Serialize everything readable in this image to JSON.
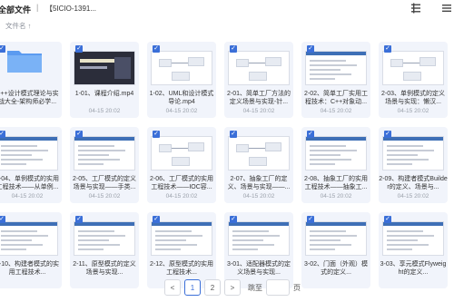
{
  "breadcrumb": {
    "root": "全部文件",
    "separator": "|",
    "current": "【5ICIO-1391..."
  },
  "sort": {
    "label": "文件名",
    "arrow": "↑"
  },
  "rows": [
    [
      {
        "name": "C++设计模式理论与实战大全-架构师必学...",
        "date": "",
        "kind": "folder"
      },
      {
        "name": "1-01、课程介绍.mp4",
        "date": "04-15 20:02",
        "kind": "dark"
      },
      {
        "name": "1-02、UML和设计模式导论.mp4",
        "date": "04-15 20:02",
        "kind": "diagram"
      },
      {
        "name": "2-01、简单工厂方法的定义场景与实现-针...",
        "date": "04-15 20:02",
        "kind": "diagram"
      },
      {
        "name": "2-02、简单工厂实用工程技术：C++对象动...",
        "date": "04-15 20:02",
        "kind": "code"
      },
      {
        "name": "2-03、单例模式的定义场景与实现：懒汉...",
        "date": "04-15 20:02",
        "kind": "diagram"
      }
    ],
    [
      {
        "name": "2-04、单例模式的实用工程技术——从单例...",
        "date": "04-15 20:02",
        "kind": "code"
      },
      {
        "name": "2-05、工厂模式的定义场景与实现——手类...",
        "date": "04-15 20:02",
        "kind": "code"
      },
      {
        "name": "2-06、工厂模式的实用工程技术——IOC容...",
        "date": "04-15 20:02",
        "kind": "diagram"
      },
      {
        "name": "2-07、抽象工厂的定义、场景与实现——...",
        "date": "04-15 20:02",
        "kind": "diagram"
      },
      {
        "name": "2-08、抽象工厂的实用工程技术——抽象工...",
        "date": "04-15 20:02",
        "kind": "code"
      },
      {
        "name": "2-09、构建者模式Builder的定义、场景与...",
        "date": "04-15 20:02",
        "kind": "code"
      }
    ],
    [
      {
        "name": "2-10、构建者模式的实用工程技术...",
        "date": "",
        "kind": "code"
      },
      {
        "name": "2-11、原型模式的定义场景与实现...",
        "date": "",
        "kind": "code"
      },
      {
        "name": "2-12、原型模式的实用工程技术...",
        "date": "",
        "kind": "code"
      },
      {
        "name": "3-01、适配器模式的定义场景与实现...",
        "date": "",
        "kind": "code"
      },
      {
        "name": "3-02、门面（外观）模式的定义...",
        "date": "",
        "kind": "code"
      },
      {
        "name": "3-03、享元模式Flyweight的定义...",
        "date": "",
        "kind": "code"
      }
    ]
  ],
  "pagination": {
    "prev": "<",
    "pages": [
      "1",
      "2"
    ],
    "current": "1",
    "next": ">",
    "jump_label": "跳至",
    "page_unit": "页"
  },
  "colors": {
    "accent": "#3b6fd8",
    "selected_bg": "#f1f4fb"
  }
}
